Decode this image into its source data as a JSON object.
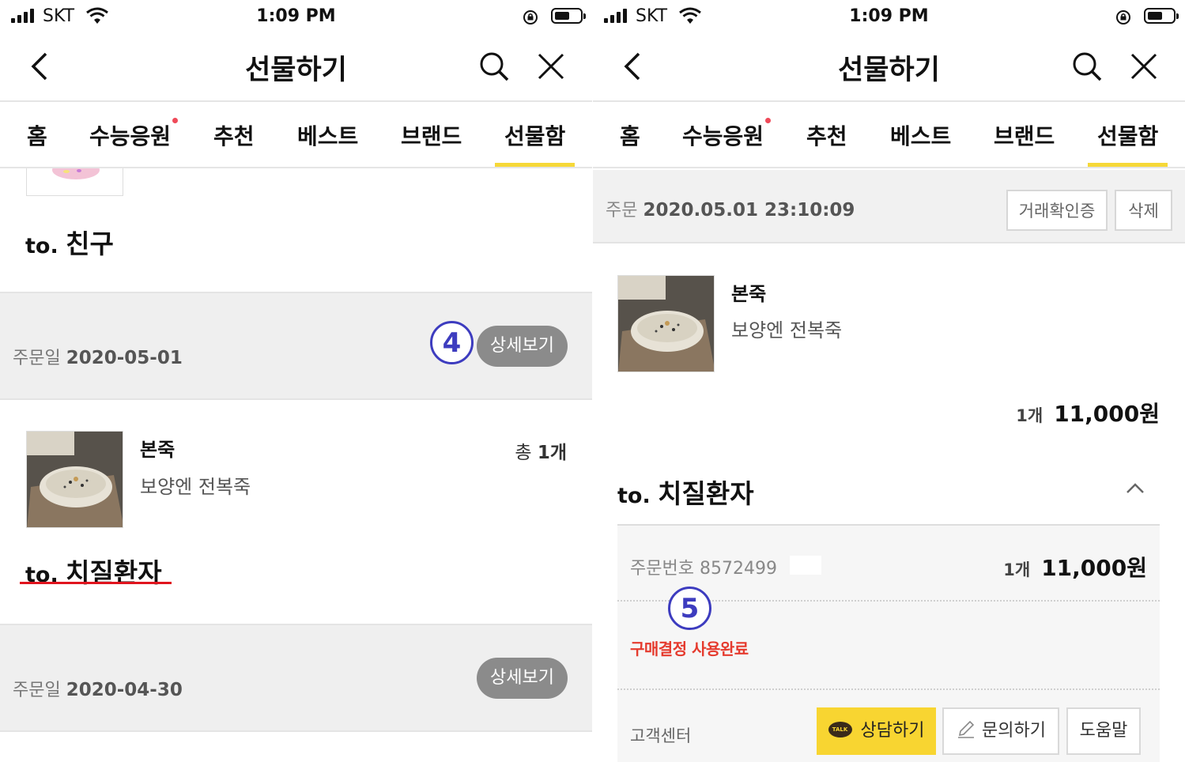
{
  "status_bar": {
    "carrier": "SKT",
    "time": "1:09 PM"
  },
  "nav": {
    "title": "선물하기"
  },
  "tabs": [
    "홈",
    "수능응원",
    "추천",
    "베스트",
    "브랜드",
    "선물함"
  ],
  "active_tab_index": 5,
  "left": {
    "to_prefix": "to.",
    "first_recipient": "친구",
    "orders": [
      {
        "date_label": "주문일",
        "date": "2020-05-01",
        "detail_button": "상세보기",
        "annotation": "4"
      },
      {
        "date_label": "주문일",
        "date": "2020-04-30",
        "detail_button": "상세보기"
      }
    ],
    "product": {
      "brand": "본죽",
      "name": "보양엔 전복죽",
      "total_label": "총",
      "total_count": "1개"
    },
    "recipient": "치질환자"
  },
  "right": {
    "order_label": "주문",
    "order_datetime": "2020.05.01 23:10:09",
    "verify_button": "거래확인증",
    "delete_button": "삭제",
    "product": {
      "brand": "본죽",
      "name": "보양엔 전복죽"
    },
    "qty": "1개",
    "price": "11,000원",
    "to_prefix": "to.",
    "recipient": "치질환자",
    "order_number_label": "주문번호",
    "order_number": "8572499",
    "detail_qty": "1개",
    "detail_price": "11,000원",
    "annotation": "5",
    "status_text": "구매결정 사용완료",
    "cs_label": "고객센터",
    "talk_icon_text": "TALK",
    "chat_button": "상담하기",
    "inquiry_button": "문의하기",
    "help_button": "도움말"
  },
  "colors": {
    "tab_underline": "#f6d838",
    "recipient_underline": "#e0141e",
    "annotation": "#3d3cbf",
    "status_red": "#e53b2e",
    "talk_yellow": "#f8d531"
  }
}
